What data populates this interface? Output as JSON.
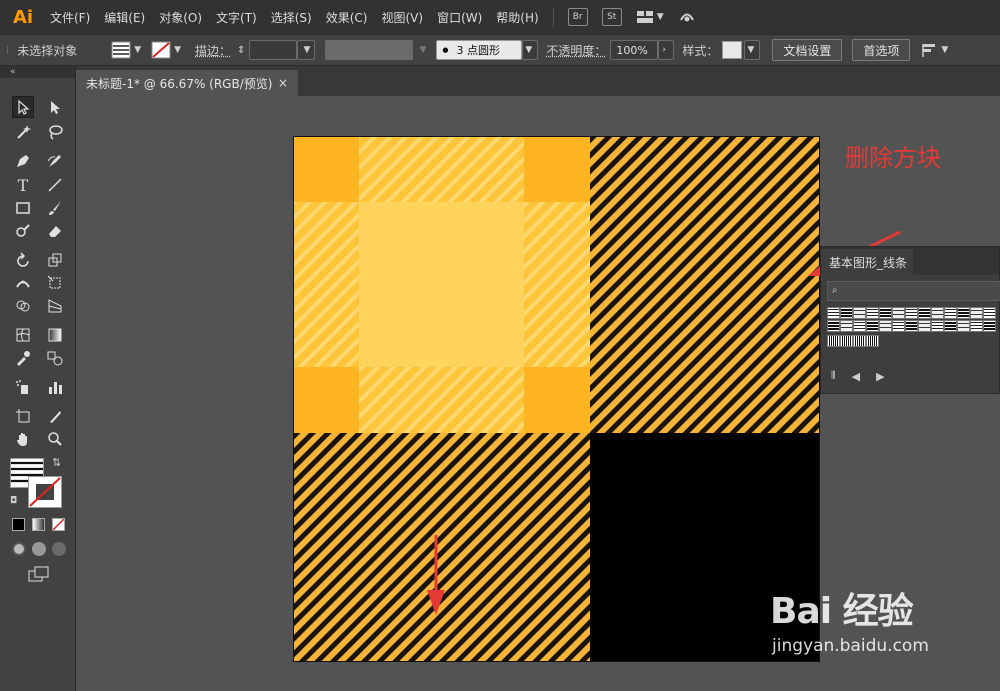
{
  "app": {
    "logo": "Ai",
    "accent": "#ff9a00"
  },
  "menu": [
    "文件(F)",
    "编辑(E)",
    "对象(O)",
    "文字(T)",
    "选择(S)",
    "效果(C)",
    "视图(V)",
    "窗口(W)",
    "帮助(H)"
  ],
  "menubar_buttons": {
    "bridge": "Br",
    "stock": "St"
  },
  "controlbar": {
    "selection": "未选择对象",
    "stroke_label": "描边：",
    "brush": "3 点圆形",
    "opacity_label": "不透明度：",
    "opacity_value": "100%",
    "style_label": "样式：",
    "doc_setup": "文档设置",
    "preferences": "首选项"
  },
  "document": {
    "tab_title": "未标题-1* @ 66.67% (RGB/预览)",
    "close": "×"
  },
  "annotation": {
    "text": "删除方块",
    "color": "#e53935"
  },
  "swatch_panel": {
    "tab": "基本图形_线条",
    "search_glyph": "⌕",
    "footer": [
      "⫴",
      "◀",
      "▶"
    ]
  },
  "artboard_colors": {
    "dark_orange": "#ffb522",
    "light_yellow": "#ffd35c",
    "stripe": "#1a1408",
    "black": "#000000"
  },
  "watermark": {
    "logo": "Bai 经验",
    "url": "jingyan.baidu.com"
  }
}
